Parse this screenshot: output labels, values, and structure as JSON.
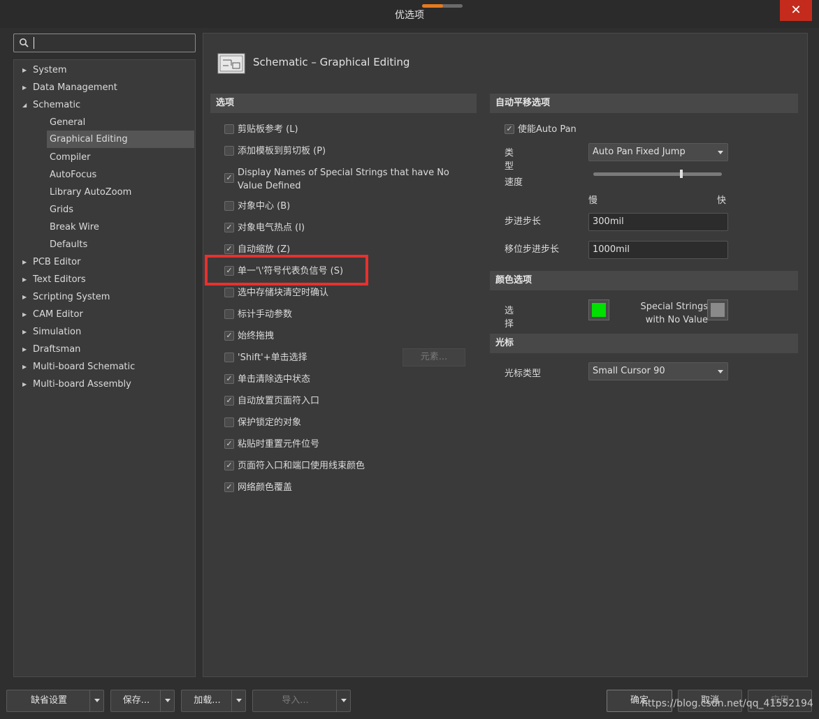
{
  "window": {
    "title": "优选项",
    "close_glyph": "✕"
  },
  "search": {
    "value": ""
  },
  "tree": {
    "items": [
      {
        "label": "System",
        "expanded": false
      },
      {
        "label": "Data Management",
        "expanded": false
      },
      {
        "label": "Schematic",
        "expanded": true
      },
      {
        "label": "General"
      },
      {
        "label": "Graphical Editing",
        "selected": true
      },
      {
        "label": "Compiler"
      },
      {
        "label": "AutoFocus"
      },
      {
        "label": "Library AutoZoom"
      },
      {
        "label": "Grids"
      },
      {
        "label": "Break Wire"
      },
      {
        "label": "Defaults"
      },
      {
        "label": "PCB Editor",
        "expanded": false
      },
      {
        "label": "Text Editors",
        "expanded": false
      },
      {
        "label": "Scripting System",
        "expanded": false
      },
      {
        "label": "CAM Editor",
        "expanded": false
      },
      {
        "label": "Simulation",
        "expanded": false
      },
      {
        "label": "Draftsman",
        "expanded": false
      },
      {
        "label": "Multi-board Schematic",
        "expanded": false
      },
      {
        "label": "Multi-board Assembly",
        "expanded": false
      }
    ]
  },
  "page": {
    "title": "Schematic – Graphical Editing"
  },
  "options": {
    "header": "选项",
    "items": [
      {
        "label": "剪贴板参考 (L)",
        "checked": false
      },
      {
        "label": "添加模板到剪切板 (P)",
        "checked": false
      },
      {
        "label": "Display Names of Special Strings that have No Value Defined",
        "checked": true
      },
      {
        "label": "对象中心 (B)",
        "checked": false
      },
      {
        "label": "对象电气热点 (I)",
        "checked": true
      },
      {
        "label": "自动缩放 (Z)",
        "checked": true
      },
      {
        "label": "单一'\\'符号代表负信号 (S)",
        "checked": true
      },
      {
        "label": "选中存储块清空时确认",
        "checked": false
      },
      {
        "label": "标计手动参数",
        "checked": false
      },
      {
        "label": "始终拖拽",
        "checked": true
      },
      {
        "label": "'Shift'+单击选择",
        "checked": false
      },
      {
        "label": "单击清除选中状态",
        "checked": true
      },
      {
        "label": "自动放置页面符入口",
        "checked": true
      },
      {
        "label": "保护锁定的对象",
        "checked": false
      },
      {
        "label": "粘贴时重置元件位号",
        "checked": true
      },
      {
        "label": "页面符入口和端口使用线束颜色",
        "checked": true
      },
      {
        "label": "网络颜色覆盖",
        "checked": true
      }
    ],
    "elements_button": "元素..."
  },
  "autopan": {
    "header": "自动平移选项",
    "enable_label": "使能Auto Pan",
    "enable_checked": true,
    "type_label": "类型",
    "type_value": "Auto Pan Fixed Jump",
    "speed_label": "速度",
    "speed_slow": "慢",
    "speed_fast": "快",
    "speed_level": 0.68,
    "step_label": "步进步长",
    "step_value": "300mil",
    "shift_step_label": "移位步进步长",
    "shift_step_value": "1000mil"
  },
  "color": {
    "header": "颜色选项",
    "select_label": "选择",
    "select_color": "#00e000",
    "special_label_1": "Special Strings",
    "special_label_2": "with No Value",
    "special_color": "#8a8a8a"
  },
  "cursor": {
    "header": "光标",
    "type_label": "光标类型",
    "type_value": "Small Cursor 90"
  },
  "footer": {
    "defaults": "缺省设置",
    "save": "保存...",
    "load": "加载...",
    "import": "导入...",
    "ok": "确定",
    "cancel": "取消",
    "apply": "应用",
    "watermark": "https://blog.csdn.net/qq_41552194"
  }
}
